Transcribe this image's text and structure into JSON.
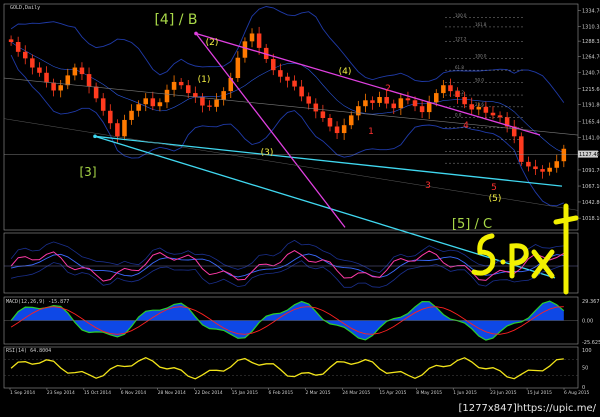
{
  "symbol_label": "GOLD,Daily",
  "watermark_text": "[1277x847]https://upic.me/",
  "colors": {
    "background": "#000000",
    "grid": "#3a3a3a",
    "bull": "#ff7a00",
    "bear": "#ff3b1f",
    "fib": "#8a8a8a",
    "channel_cyan": "#40d8f0",
    "channel_magenta": "#e040e0",
    "bands": "#1f3aa8",
    "label_yellow": "#f4f042",
    "label_green": "#a8d848",
    "label_red": "#ff3030",
    "macd_fill": "#1050ff",
    "macd_line": "#2bd02b",
    "macd_signal": "#ff2020",
    "rsi_line": "#f2e41a",
    "osc_pink": "#ff3aa8",
    "osc_blue": "#3a6aff"
  },
  "chart_data": [
    {
      "type": "candlestick",
      "title": "GOLD,Daily",
      "price_ticks": [
        1334.7,
        1310.35,
        1288.35,
        1264.7,
        1240.7,
        1215.6,
        1191.8,
        1165.4,
        1141.0,
        1116.65,
        1091.7,
        1067.1,
        1042.8,
        1018.1
      ],
      "x_tick_labels": [
        "1 Sep 2014",
        "23 Sep 2014",
        "15 Oct 2014",
        "6 Nov 2014",
        "28 Nov 2014",
        "22 Dec 2014",
        "15 Jan 2015",
        "6 Feb 2015",
        "2 Mar 2015",
        "24 Mar 2015",
        "15 Apr 2015",
        "8 May 2015",
        "1 Jun 2015",
        "23 Jun 2015",
        "15 Jul 2015",
        "6 Aug 2015"
      ],
      "current_price_tag": "1127.48",
      "closes_approx": [
        1287,
        1272,
        1262,
        1248,
        1240,
        1225,
        1213,
        1221,
        1236,
        1248,
        1238,
        1219,
        1201,
        1182,
        1163,
        1143,
        1168,
        1182,
        1192,
        1201,
        1189,
        1195,
        1214,
        1226,
        1221,
        1209,
        1203,
        1190,
        1188,
        1199,
        1212,
        1232,
        1263,
        1288,
        1300,
        1278,
        1261,
        1244,
        1234,
        1228,
        1219,
        1204,
        1193,
        1181,
        1171,
        1158,
        1148,
        1160,
        1175,
        1189,
        1198,
        1194,
        1203,
        1193,
        1186,
        1201,
        1198,
        1189,
        1180,
        1195,
        1209,
        1221,
        1212,
        1203,
        1192,
        1184,
        1188,
        1179,
        1175,
        1172,
        1158,
        1143,
        1104,
        1097,
        1093,
        1089,
        1095,
        1105,
        1124
      ],
      "wave_labels": [
        {
          "text": "[4] / B",
          "color_key": "label_green"
        },
        {
          "text": "(2)",
          "color_key": "label_yellow"
        },
        {
          "text": "(1)",
          "color_key": "label_yellow"
        },
        {
          "text": "(4)",
          "color_key": "label_yellow"
        },
        {
          "text": "(3)",
          "color_key": "label_yellow"
        },
        {
          "text": "(5)",
          "color_key": "label_yellow"
        },
        {
          "text": "[3]",
          "color_key": "label_green"
        },
        {
          "text": "[5] / C",
          "color_key": "label_green"
        },
        {
          "text": "1",
          "color_key": "label_red"
        },
        {
          "text": "2",
          "color_key": "label_red"
        },
        {
          "text": "3",
          "color_key": "label_red"
        },
        {
          "text": "4",
          "color_key": "label_red"
        },
        {
          "text": "5",
          "color_key": "label_red"
        }
      ],
      "fib_levels": [
        "100.0",
        "161.8",
        "127.2",
        "100.0",
        "61.8",
        "50.0",
        "38.2",
        "23.6",
        "0.0"
      ]
    },
    {
      "type": "line",
      "title": "",
      "y_ticks": [],
      "note_series": "oscillator with pink and blue lines inside envelope"
    },
    {
      "type": "area",
      "title": "MACD(12,26,9)",
      "y_ticks": [
        "29.367",
        "0.00",
        "-25.625"
      ]
    },
    {
      "type": "line",
      "title": "RSI(14)",
      "y_ticks": [
        "100",
        "50",
        "0"
      ]
    }
  ],
  "labels": {
    "macd_header": "MACD(12,26,9) -15.877",
    "rsi_header": "RSI(14) 64.8004"
  },
  "logo_text": "5·Px"
}
